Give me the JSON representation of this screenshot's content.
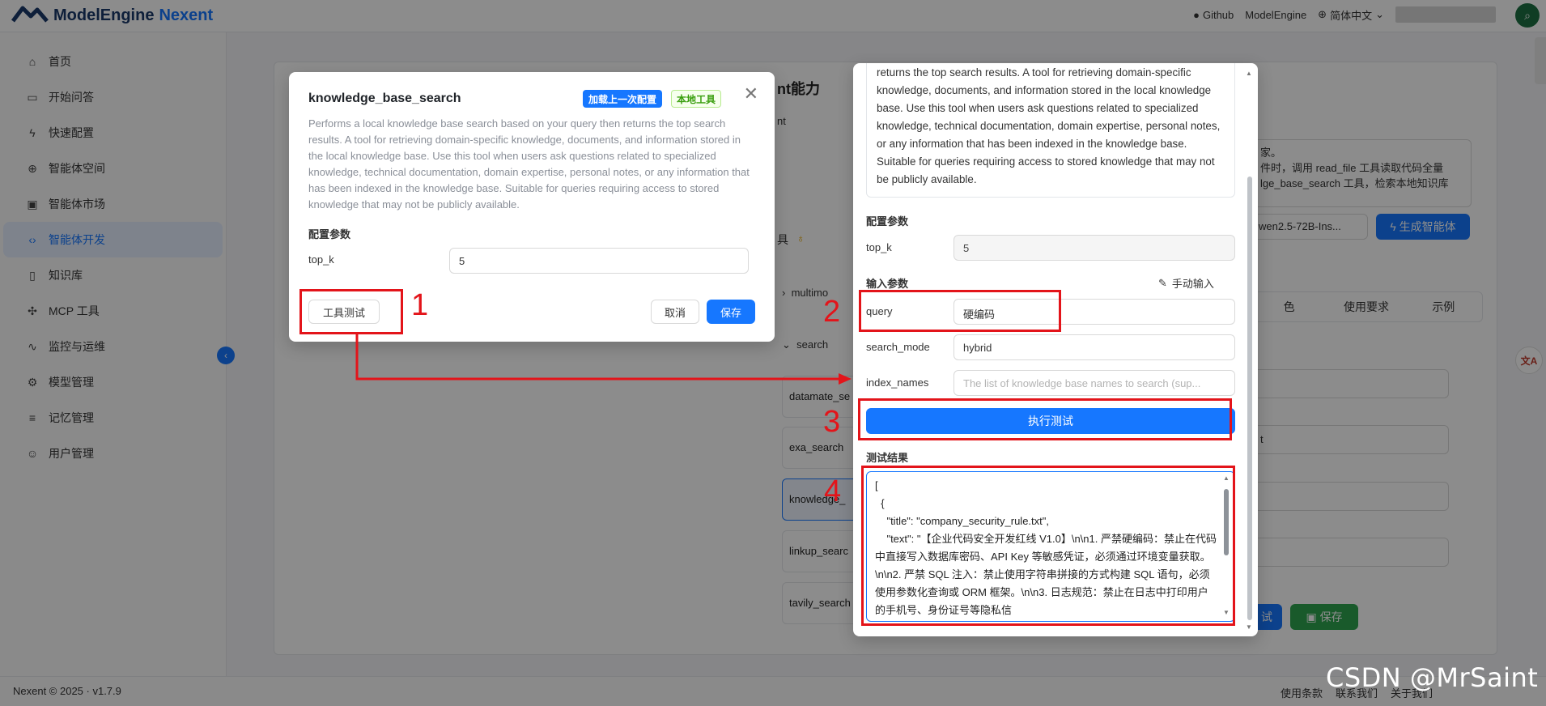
{
  "header": {
    "brand_name": "ModelEngine",
    "brand_product": "Nexent",
    "links": [
      "Github",
      "ModelEngine",
      "简体中文"
    ],
    "user_avatar_icon": "search-icon"
  },
  "sidebar": {
    "items": [
      {
        "label": "首页",
        "icon": "home-icon"
      },
      {
        "label": "开始问答",
        "icon": "chat-icon"
      },
      {
        "label": "快速配置",
        "icon": "bolt-icon"
      },
      {
        "label": "智能体空间",
        "icon": "globe-icon"
      },
      {
        "label": "智能体市场",
        "icon": "store-icon"
      },
      {
        "label": "智能体开发",
        "icon": "code-icon"
      },
      {
        "label": "知识库",
        "icon": "book-icon"
      },
      {
        "label": "MCP 工具",
        "icon": "puzzle-icon"
      },
      {
        "label": "监控与运维",
        "icon": "pulse-icon"
      },
      {
        "label": "模型管理",
        "icon": "gear-icon"
      },
      {
        "label": "记忆管理",
        "icon": "database-icon"
      },
      {
        "label": "用户管理",
        "icon": "users-icon"
      }
    ],
    "active_index": 5
  },
  "background": {
    "section_title_fragment": "nt能力",
    "sub_fragment": "nt",
    "tools_label_fragment": "具",
    "prompt_fragment_lines": [
      "家。",
      "件时，调用 read_file 工具读取代码全量",
      "lge_base_search 工具，检索本地知识库"
    ],
    "model_fragment": "wen2.5-72B-Ins...",
    "generate_button": "生成智能体",
    "tool_groups": [
      "multimo",
      "search"
    ],
    "tool_items": [
      "datamate_se",
      "exa_search",
      "knowledge_",
      "linkup_searc",
      "tavily_search"
    ],
    "tabs": [
      "色",
      "使用要求",
      "示例"
    ],
    "field_fragment": "t",
    "debug_fragment": "试",
    "save_button": "保存"
  },
  "footer": {
    "copyright": "Nexent © 2025 · v1.7.9",
    "links": [
      "使用条款",
      "联系我们",
      "关于我们"
    ]
  },
  "dialog_tool_config": {
    "title": "knowledge_base_search",
    "tag_load_last": "加载上一次配置",
    "tag_local_tool": "本地工具",
    "description": "Performs a local knowledge base search based on your query then returns the top search results. A tool for retrieving domain-specific knowledge, documents, and information stored in the local knowledge base. Use this tool when users ask questions related to specialized knowledge, technical documentation, domain expertise, personal notes, or any information that has been indexed in the knowledge base. Suitable for queries requiring access to stored knowledge that may not be publicly available.",
    "config_section": "配置参数",
    "param_label": "top_k",
    "param_value": "5",
    "test_button": "工具测试",
    "cancel_button": "取消",
    "save_button": "保存"
  },
  "dialog_tool_test": {
    "description_visible": "returns the top search results. A tool for retrieving domain-specific knowledge, documents, and information stored in the local knowledge base. Use this tool when users ask questions related to specialized knowledge, technical documentation, domain expertise, personal notes, or any information that has been indexed in the knowledge base. Suitable for queries requiring access to stored knowledge that may not be publicly available.",
    "config_section": "配置参数",
    "config_param_label": "top_k",
    "config_param_value": "5",
    "input_section": "输入参数",
    "manual_input": "手动输入",
    "inputs": [
      {
        "label": "query",
        "value": "硬编码",
        "placeholder": ""
      },
      {
        "label": "search_mode",
        "value": "hybrid",
        "placeholder": ""
      },
      {
        "label": "index_names",
        "value": "",
        "placeholder": "The list of knowledge base names to search (sup..."
      }
    ],
    "run_button": "执行测试",
    "result_section": "测试结果",
    "result_text": "[\n  {\n    \"title\": \"company_security_rule.txt\",\n    \"text\": \"【企业代码安全开发红线 V1.0】\\n\\n1. 严禁硬编码：禁止在代码中直接写入数据库密码、API Key 等敏感凭证，必须通过环境变量获取。\\n\\n2. 严禁 SQL 注入：禁止使用字符串拼接的方式构建 SQL 语句，必须使用参数化查询或 ORM 框架。\\n\\n3. 日志规范：禁止在日志中打印用户的手机号、身份证号等隐私信"
  },
  "annotations": [
    "1",
    "2",
    "3",
    "4"
  ],
  "watermark": "CSDN @MrSaint",
  "colors": {
    "accent": "#1677ff",
    "annotation": "#e3141a",
    "success": "#2ea44f"
  }
}
